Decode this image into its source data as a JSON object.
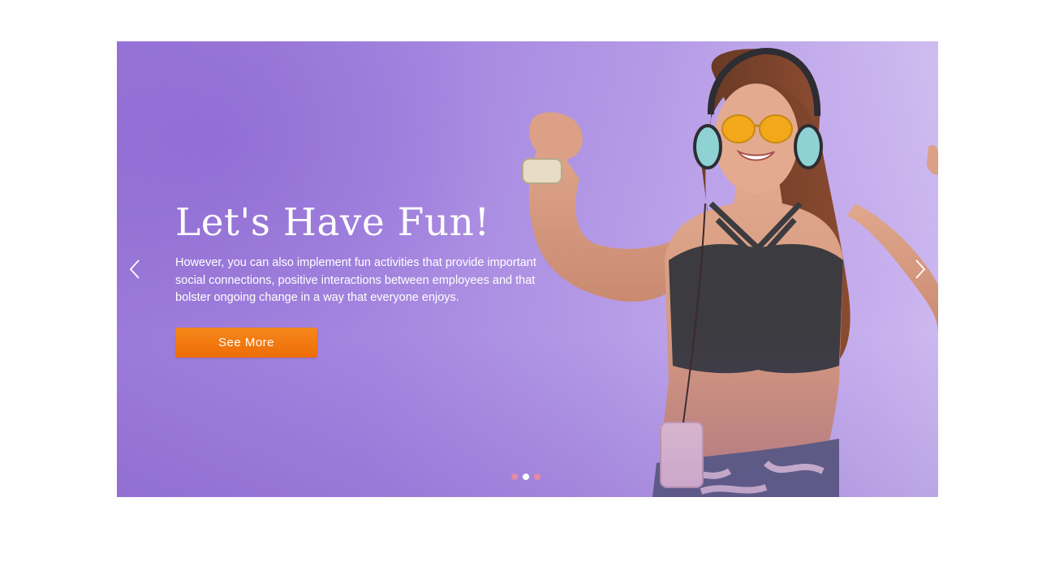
{
  "slide": {
    "title": "Let's Have Fun!",
    "description": "However, you can also implement fun activities that provide important social connections, positive interactions between employees and that bolster ongoing change in a way that everyone enjoys.",
    "button_label": "See More",
    "image_icon": "woman-with-headphones-photo"
  },
  "navigation": {
    "prev_icon": "chevron-left-icon",
    "next_icon": "chevron-right-icon"
  },
  "pagination": {
    "total": 3,
    "active_index": 1
  },
  "colors": {
    "background": "#a587e0",
    "button": "#f07a10",
    "dot_inactive": "#e58aa3",
    "dot_active": "#ffffff"
  }
}
